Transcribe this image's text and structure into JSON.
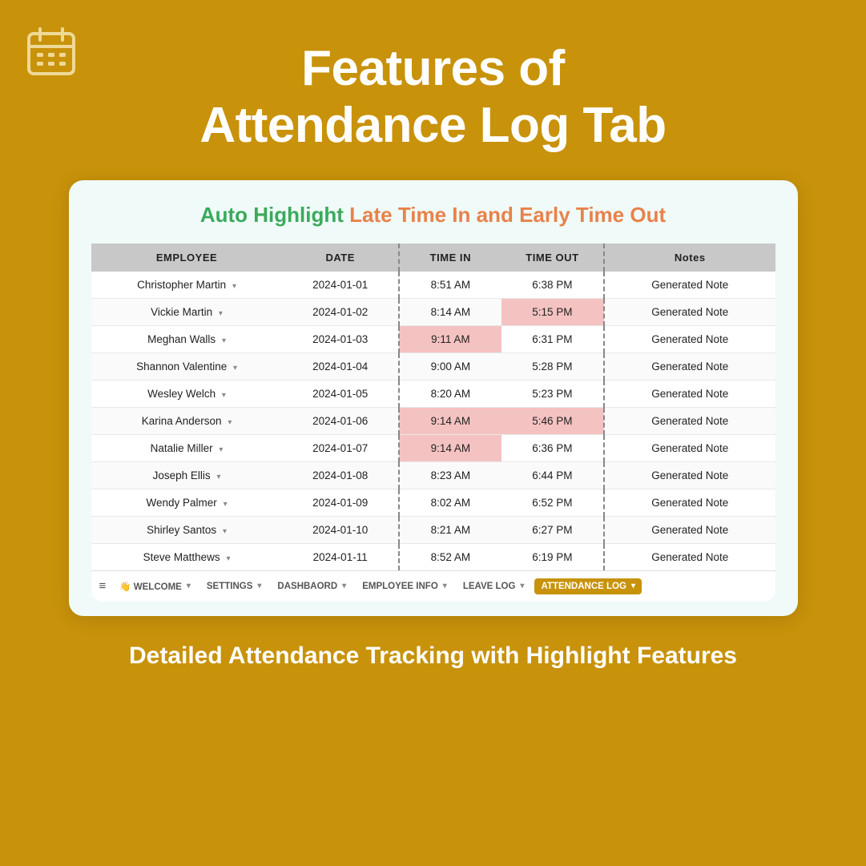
{
  "page": {
    "background_color": "#C8920A",
    "header_title_line1": "Features of",
    "header_title_line2": "Attendance Log Tab",
    "footer_subtitle": "Detailed Attendance Tracking with Highlight Features"
  },
  "card": {
    "subtitle_part1": "Auto Highlight",
    "subtitle_part2": "Late Time In",
    "subtitle_part3": "and",
    "subtitle_part4": "Early Time Out"
  },
  "table": {
    "columns": [
      "EMPLOYEE",
      "DATE",
      "TIME IN",
      "TIME OUT",
      "Notes"
    ],
    "rows": [
      {
        "employee": "Christopher Martin",
        "date": "2024-01-01",
        "time_in": "8:51 AM",
        "time_out": "6:38 PM",
        "note": "Generated Note",
        "late_in": false,
        "early_out": false
      },
      {
        "employee": "Vickie Martin",
        "date": "2024-01-02",
        "time_in": "8:14 AM",
        "time_out": "5:15 PM",
        "note": "Generated Note",
        "late_in": false,
        "early_out": true
      },
      {
        "employee": "Meghan Walls",
        "date": "2024-01-03",
        "time_in": "9:11 AM",
        "time_out": "6:31 PM",
        "note": "Generated Note",
        "late_in": true,
        "early_out": false
      },
      {
        "employee": "Shannon Valentine",
        "date": "2024-01-04",
        "time_in": "9:00 AM",
        "time_out": "5:28 PM",
        "note": "Generated Note",
        "late_in": false,
        "early_out": false
      },
      {
        "employee": "Wesley Welch",
        "date": "2024-01-05",
        "time_in": "8:20 AM",
        "time_out": "5:23 PM",
        "note": "Generated Note",
        "late_in": false,
        "early_out": false
      },
      {
        "employee": "Karina Anderson",
        "date": "2024-01-06",
        "time_in": "9:14 AM",
        "time_out": "5:46 PM",
        "note": "Generated Note",
        "late_in": true,
        "early_out": true
      },
      {
        "employee": "Natalie Miller",
        "date": "2024-01-07",
        "time_in": "9:14 AM",
        "time_out": "6:36 PM",
        "note": "Generated Note",
        "late_in": true,
        "early_out": false
      },
      {
        "employee": "Joseph Ellis",
        "date": "2024-01-08",
        "time_in": "8:23 AM",
        "time_out": "6:44 PM",
        "note": "Generated Note",
        "late_in": false,
        "early_out": false
      },
      {
        "employee": "Wendy Palmer",
        "date": "2024-01-09",
        "time_in": "8:02 AM",
        "time_out": "6:52 PM",
        "note": "Generated Note",
        "late_in": false,
        "early_out": false
      },
      {
        "employee": "Shirley Santos",
        "date": "2024-01-10",
        "time_in": "8:21 AM",
        "time_out": "6:27 PM",
        "note": "Generated Note",
        "late_in": false,
        "early_out": false
      },
      {
        "employee": "Steve Matthews",
        "date": "2024-01-11",
        "time_in": "8:52 AM",
        "time_out": "6:19 PM",
        "note": "Generated Note",
        "late_in": false,
        "early_out": false
      }
    ]
  },
  "navbar": {
    "items": [
      {
        "label": "≡",
        "type": "hamburger"
      },
      {
        "label": "👋 WELCOME",
        "active": false
      },
      {
        "label": "SETTINGS",
        "active": false
      },
      {
        "label": "DASHBAORD",
        "active": false
      },
      {
        "label": "EMPLOYEE INFO",
        "active": false
      },
      {
        "label": "LEAVE LOG",
        "active": false
      },
      {
        "label": "ATTENDANCE LOG",
        "active": true
      }
    ]
  }
}
